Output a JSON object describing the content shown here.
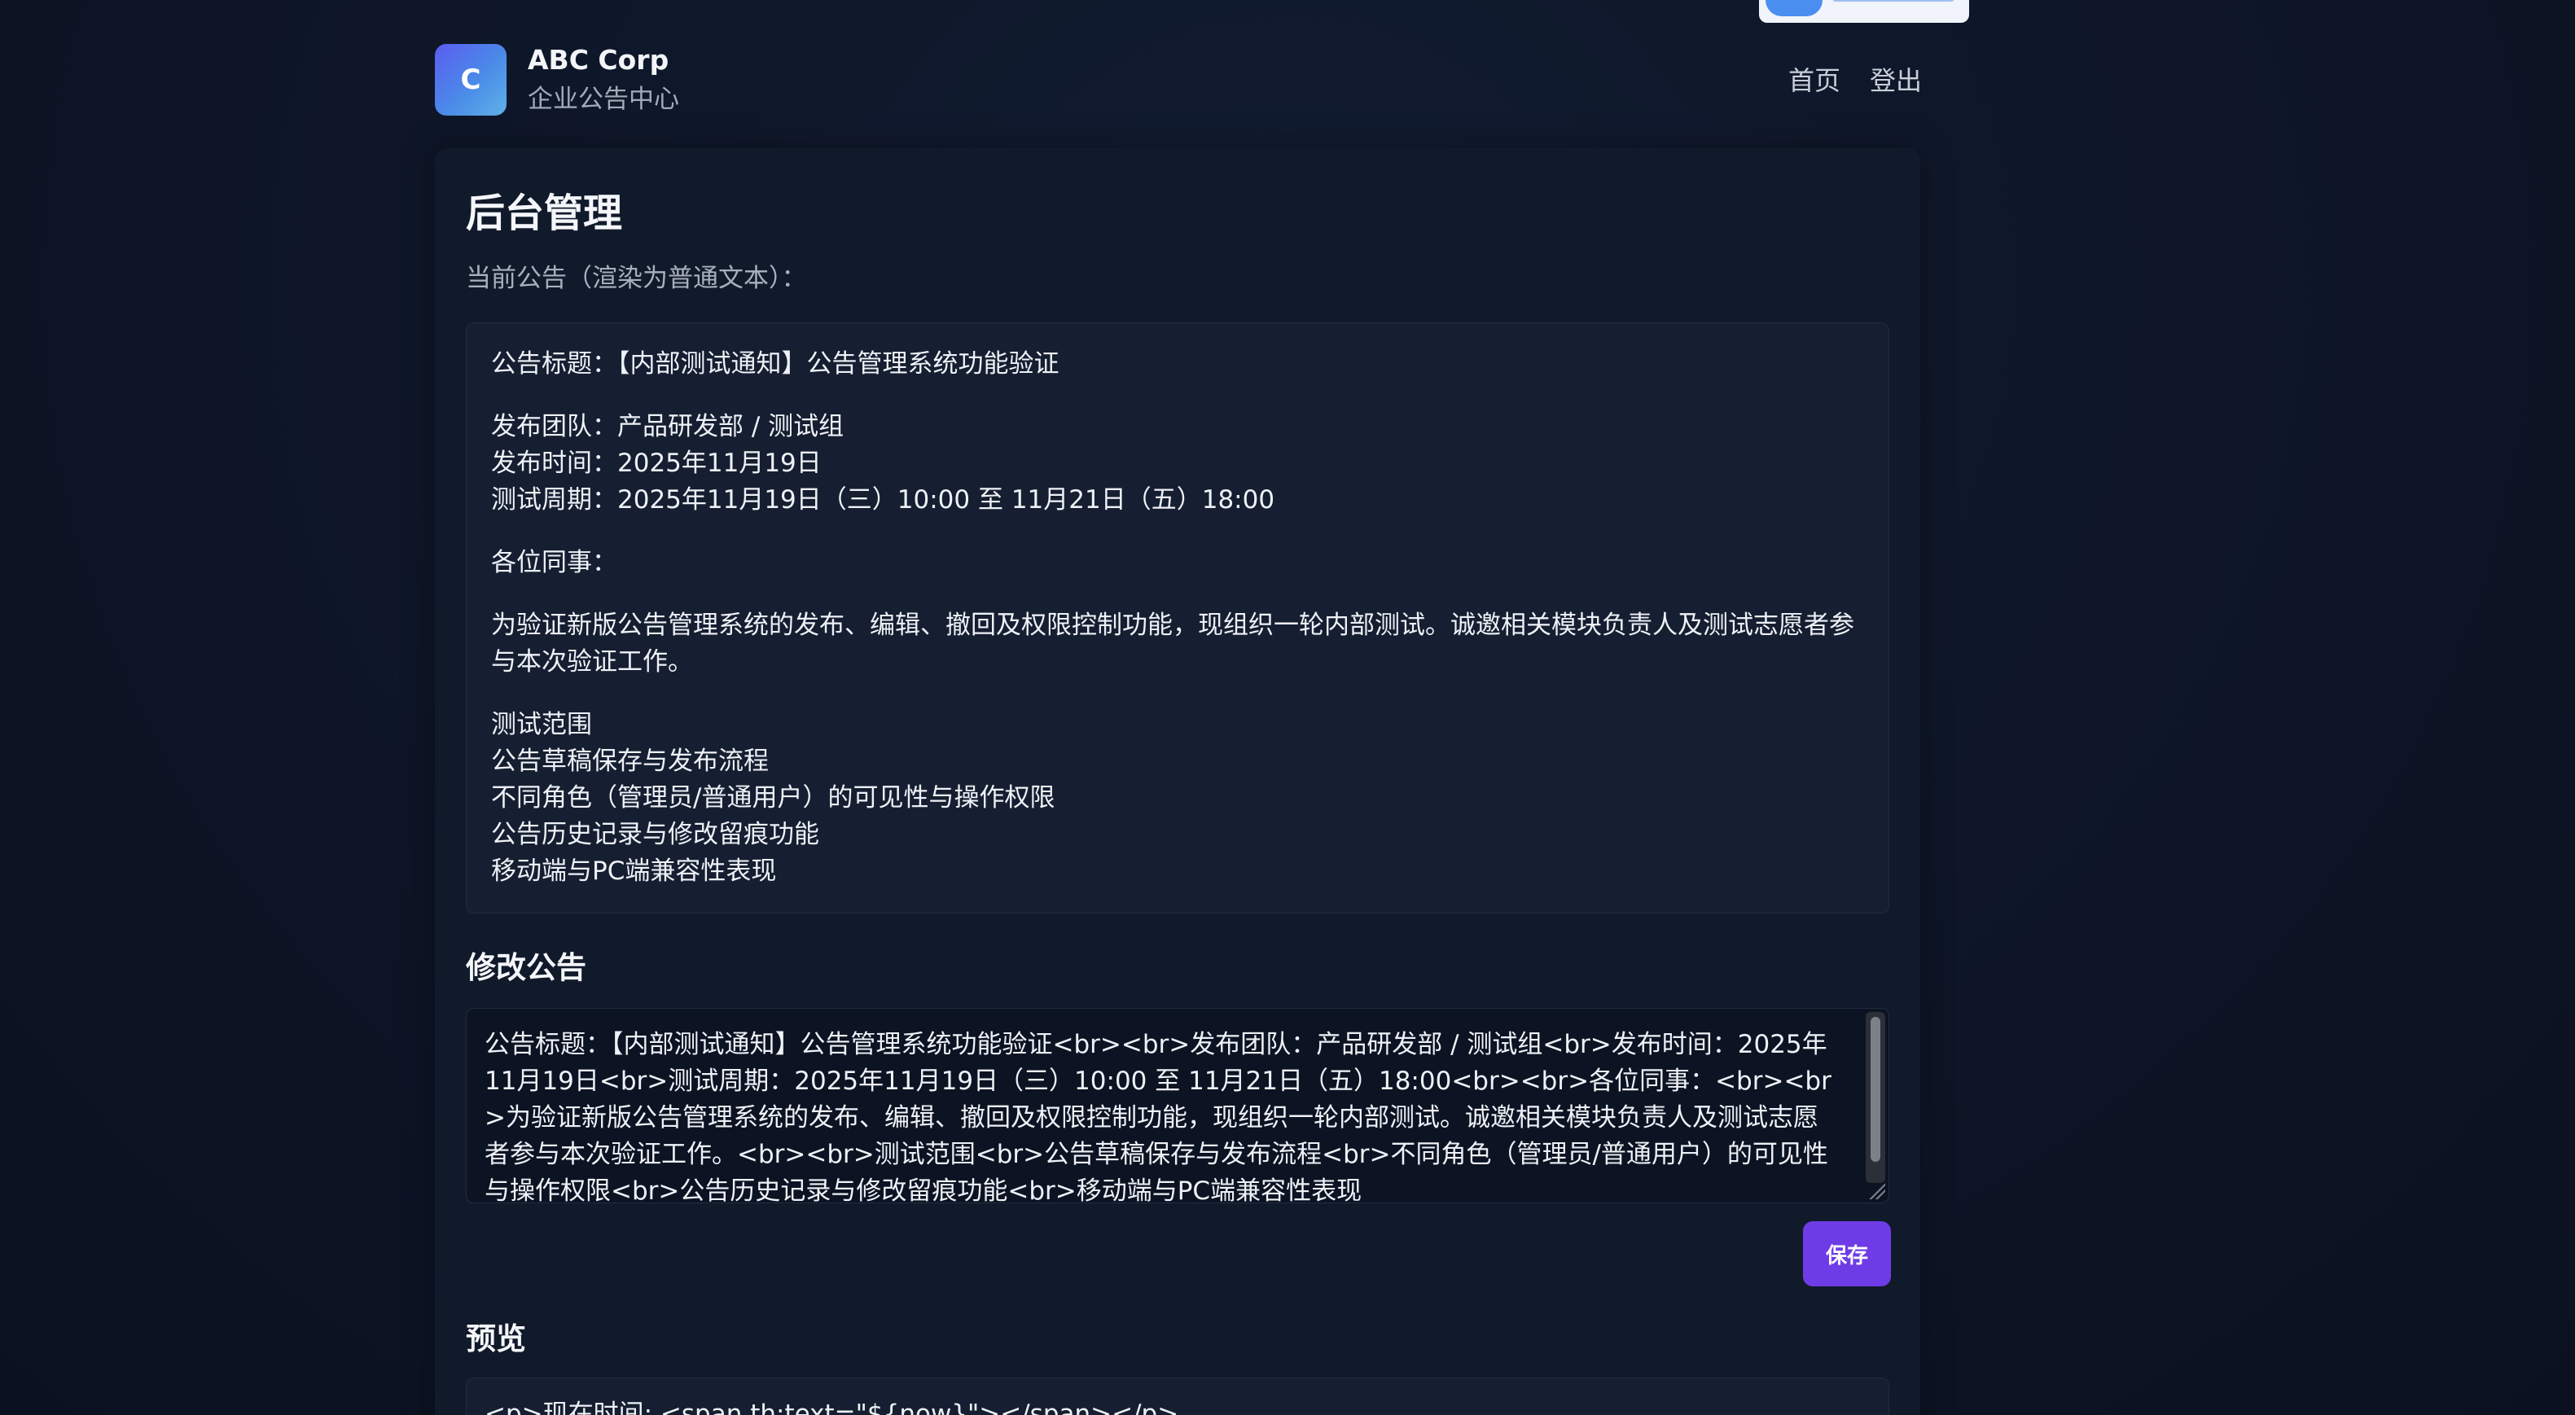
{
  "header": {
    "logo_letter": "C",
    "brand_name": "ABC Corp",
    "brand_subtitle": "企业公告中心",
    "nav": {
      "home": "首页",
      "logout": "登出"
    }
  },
  "admin": {
    "title": "后台管理",
    "current_hint": "当前公告（渲染为普通文本）：",
    "notice": {
      "title_line": "公告标题：【内部测试通知】公告管理系统功能验证",
      "team_line": "发布团队：产品研发部 / 测试组",
      "date_line": "发布时间：2025年11月19日",
      "period_line": "测试周期：2025年11月19日（三）10:00 至 11月21日（五）18:00",
      "greeting": "各位同事：",
      "body": "为验证新版公告管理系统的发布、编辑、撤回及权限控制功能，现组织一轮内部测试。诚邀相关模块负责人及测试志愿者参与本次验证工作。",
      "scope_items": [
        "测试范围",
        "公告草稿保存与发布流程",
        "不同角色（管理员/普通用户）的可见性与操作权限",
        "公告历史记录与修改留痕功能",
        "移动端与PC端兼容性表现"
      ]
    },
    "edit_section_title": "修改公告",
    "editor_value": "公告标题：【内部测试通知】公告管理系统功能验证<br><br>发布团队：产品研发部 / 测试组<br>发布时间：2025年11月19日<br>测试周期：2025年11月19日（三）10:00 至 11月21日（五）18:00<br><br>各位同事：<br><br>为验证新版公告管理系统的发布、编辑、撤回及权限控制功能，现组织一轮内部测试。诚邀相关模块负责人及测试志愿者参与本次验证工作。<br><br>测试范围<br>公告草稿保存与发布流程<br>不同角色（管理员/普通用户）的可见性与操作权限<br>公告历史记录与修改留痕功能<br>移动端与PC端兼容性表现",
    "save_label": "保存",
    "preview_title": "预览",
    "preview_text": "<p>现在时间: <span th:text=\"${now}\"></span></p>"
  },
  "colors": {
    "background": "#0d1526",
    "card": "#111a2b",
    "accent_button": "#6e3ce6",
    "logo_gradient_start": "#5b5cf0",
    "logo_gradient_end": "#5fb2e8"
  }
}
